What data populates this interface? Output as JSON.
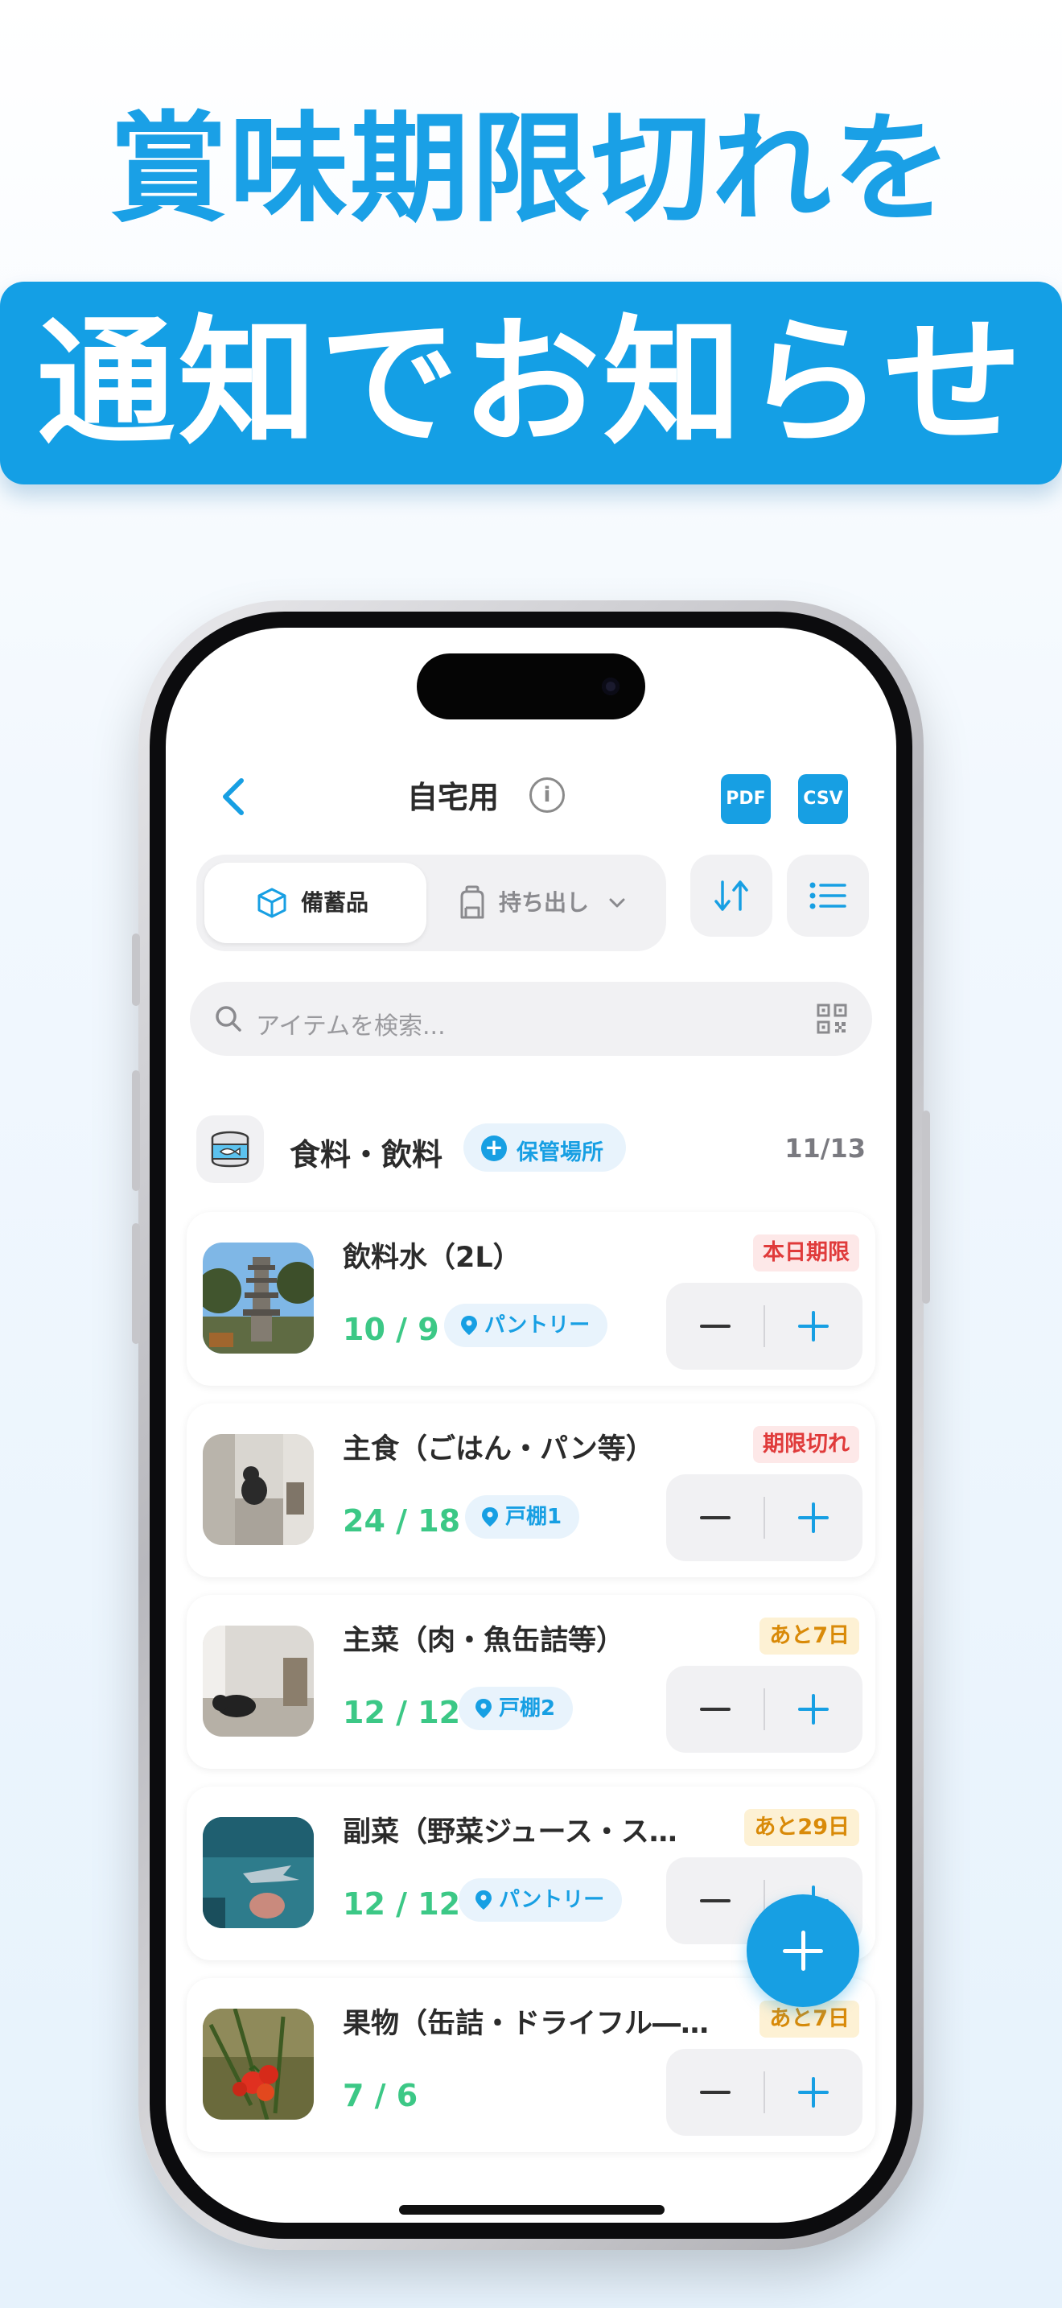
{
  "headline": {
    "line1": "賞味期限切れを",
    "line2": "通知でお知らせ"
  },
  "nav": {
    "title": "自宅用",
    "info_icon": "info-icon",
    "pdf_label": "PDF",
    "csv_label": "CSV"
  },
  "tabs": {
    "active": "備蓄品",
    "inactive": "持ち出し"
  },
  "search": {
    "placeholder": "アイテムを検索..."
  },
  "category": {
    "title": "食料・飲料",
    "storage_button": "保管場所",
    "count": "11/13"
  },
  "items": [
    {
      "name": "飲料水（2L）",
      "badge": "本日期限",
      "badge_type": "red",
      "qty": "10 / 9",
      "location": "パントリー"
    },
    {
      "name": "主食（ごはん・パン等）",
      "badge": "期限切れ",
      "badge_type": "red",
      "qty": "24 / 18",
      "location": "戸棚1"
    },
    {
      "name": "主菜（肉・魚缶詰等）",
      "badge": "あと7日",
      "badge_type": "orange",
      "qty": "12 / 12",
      "location": "戸棚2"
    },
    {
      "name": "副菜（野菜ジュース・ス…",
      "badge": "あと29日",
      "badge_type": "orange",
      "qty": "12 / 12",
      "location": "パントリー"
    },
    {
      "name": "果物（缶詰・ドライフル―…",
      "badge": "あと7日",
      "badge_type": "orange",
      "qty": "7 / 6",
      "location": ""
    }
  ],
  "colors": {
    "accent": "#179fe3",
    "quantity": "#3cc886",
    "expired": "#e03b3b",
    "warning": "#d98a08"
  }
}
